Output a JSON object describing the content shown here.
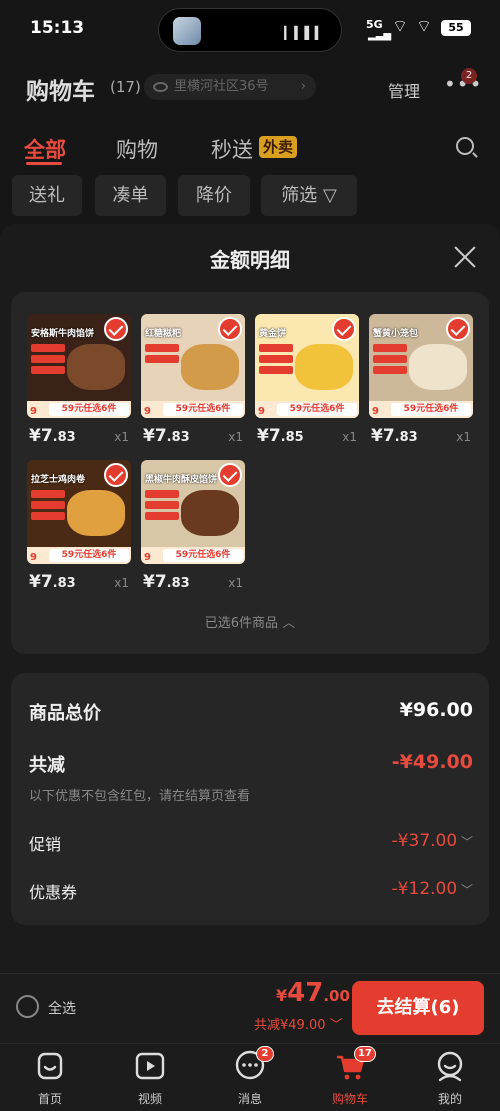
{
  "status_bar": {
    "time": "15:13",
    "signal": "5G",
    "battery": "55"
  },
  "header": {
    "title": "购物车",
    "count": "(17)",
    "location": "里横河社区36号",
    "manage": "管理",
    "more_badge": "2"
  },
  "tabs": [
    {
      "label": "全部",
      "active": true
    },
    {
      "label": "购物",
      "active": false
    },
    {
      "label": "秒送",
      "active": false,
      "tag": "外卖"
    }
  ],
  "filters": [
    "送礼",
    "凑单",
    "降价",
    "筛选"
  ],
  "sheet": {
    "title": "金额明细",
    "products": [
      {
        "title": "安格斯牛肉馅饼",
        "promo": "59元任选6件",
        "badge": "9",
        "price_int": "¥7",
        "price_dec": ".83",
        "qty": "x1",
        "color": "#7a4a2a"
      },
      {
        "title": "红糖糍粑",
        "promo": "59元任选6件",
        "badge": "9",
        "price_int": "¥7",
        "price_dec": ".83",
        "qty": "x1",
        "color": "#d39a4a"
      },
      {
        "title": "黄金饼",
        "promo": "59元任选6件",
        "badge": "9",
        "price_int": "¥7",
        "price_dec": ".85",
        "qty": "x1",
        "color": "#f2c23a"
      },
      {
        "title": "蟹黄小笼包",
        "promo": "59元任选6件",
        "badge": "9",
        "price_int": "¥7",
        "price_dec": ".83",
        "qty": "x1",
        "color": "#d9c9a8"
      },
      {
        "title": "拉芝士鸡肉卷",
        "promo": "59元任选6件",
        "badge": "9",
        "price_int": "¥7",
        "price_dec": ".83",
        "qty": "x1",
        "color": "#e0a040"
      },
      {
        "title": "黑椒牛肉酥皮馅饼",
        "promo": "59元任选6件",
        "badge": "9",
        "price_int": "¥7",
        "price_dec": ".83",
        "qty": "x1",
        "color": "#6a3a20"
      }
    ],
    "selected_info": "已选6件商品",
    "summary": {
      "total_label": "商品总价",
      "total_value": "¥96.00",
      "discount_label": "共减",
      "discount_value": "-¥49.00",
      "note": "以下优惠不包含红包，请在结算页查看",
      "promo_label": "促销",
      "promo_value": "-¥37.00",
      "coupon_label": "优惠券",
      "coupon_value": "-¥12.00"
    }
  },
  "checkout": {
    "select_all": "全选",
    "yen": "¥",
    "total_big": "47",
    "total_dec": ".00",
    "saved": "共减¥49.00",
    "button": "去结算(6)"
  },
  "nav": [
    {
      "label": "首页",
      "icon": "home-icon",
      "badge": ""
    },
    {
      "label": "视频",
      "icon": "video-icon",
      "badge": ""
    },
    {
      "label": "消息",
      "icon": "message-icon",
      "badge": "2"
    },
    {
      "label": "购物车",
      "icon": "cart-icon",
      "badge": "17",
      "active": true
    },
    {
      "label": "我的",
      "icon": "profile-icon",
      "badge": ""
    }
  ],
  "colors": {
    "accent": "#e43c2e",
    "background": "#161616",
    "card": "#262626"
  }
}
